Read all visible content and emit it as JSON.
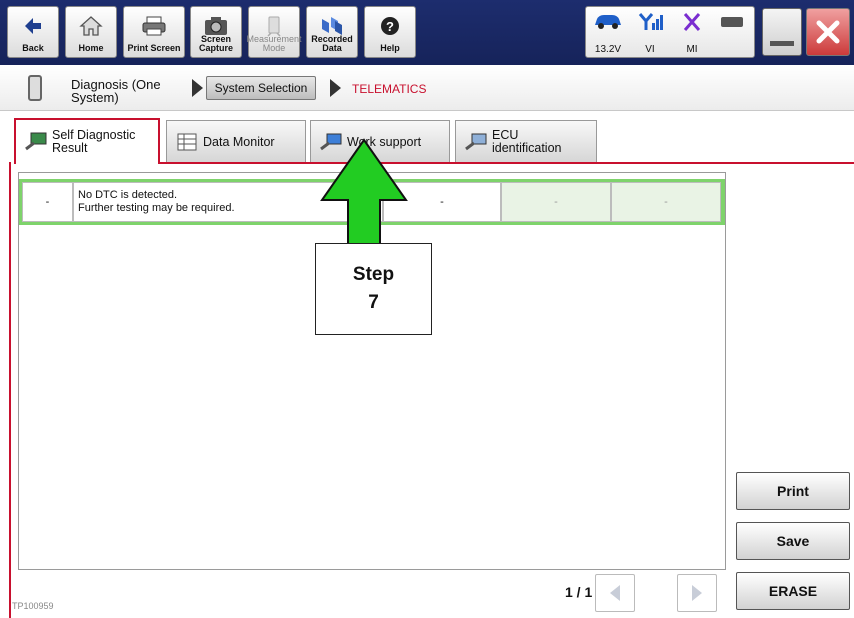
{
  "toolbar": {
    "buttons": [
      {
        "label": "Back",
        "icon": "back-arrow-icon"
      },
      {
        "label": "Home",
        "icon": "home-icon"
      },
      {
        "label": "Print Screen",
        "icon": "printer-icon"
      },
      {
        "label": "Screen Capture",
        "icon": "camera-icon"
      },
      {
        "label": "Measurement Mode",
        "icon": "measurement-icon",
        "disabled": true
      },
      {
        "label": "Recorded Data",
        "icon": "recorded-data-icon"
      },
      {
        "label": "Help",
        "icon": "help-icon"
      }
    ],
    "status": {
      "voltage": "13.2V",
      "vi_label": "VI",
      "mi_label": "MI"
    },
    "colors": {
      "bar": "#1d2d6e",
      "close": "#cc3a3a"
    }
  },
  "breadcrumb": {
    "level1": "Diagnosis (One System)",
    "level2": "System Selection",
    "current": "TELEMATICS"
  },
  "tabs": [
    {
      "label": "Self Diagnostic Result",
      "active": true
    },
    {
      "label": "Data Monitor"
    },
    {
      "label": "Work support"
    },
    {
      "label": "ECU identification"
    }
  ],
  "results": {
    "rows": [
      {
        "col1": "-",
        "message_line1": "No DTC is detected.",
        "message_line2": "Further testing may be required.",
        "col3": "-",
        "col4": "-",
        "col5": "-"
      }
    ]
  },
  "annotation": {
    "line1": "Step",
    "line2": "7",
    "arrow_color": "#22cc22"
  },
  "side_buttons": {
    "print": "Print",
    "save": "Save",
    "erase": "ERASE"
  },
  "pager": {
    "text": "1 / 1"
  },
  "footer": {
    "code": "TP100959"
  },
  "accent_color": "#c8102e"
}
